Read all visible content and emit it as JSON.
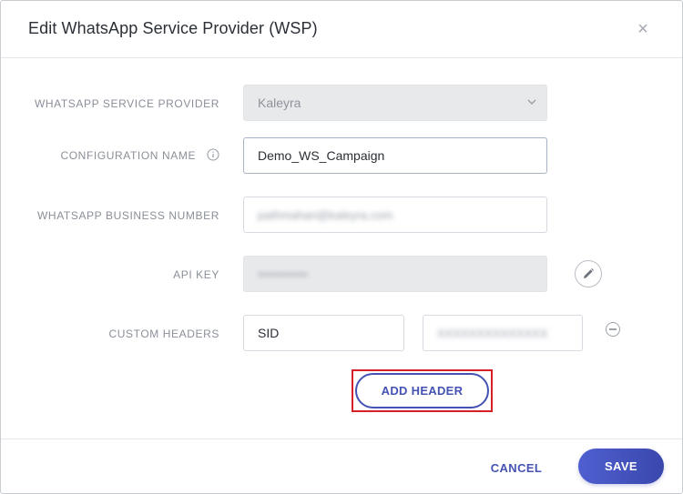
{
  "dialog": {
    "title": "Edit WhatsApp Service Provider (WSP)",
    "close_symbol": "×"
  },
  "form": {
    "provider": {
      "label": "WHATSAPP SERVICE PROVIDER",
      "value": "Kaleyra"
    },
    "config_name": {
      "label": "CONFIGURATION NAME",
      "value": "Demo_WS_Campaign"
    },
    "business_number": {
      "label": "WHATSAPP BUSINESS NUMBER",
      "value": "pathmahari@kaleyra.com"
    },
    "api_key": {
      "label": "API KEY",
      "value": "••••••••••••"
    },
    "custom_headers": {
      "label": "CUSTOM HEADERS",
      "header_name": "SID",
      "header_value": "XXXXXXXXXXXXXX"
    },
    "add_header_label": "ADD HEADER"
  },
  "footer": {
    "cancel_label": "CANCEL",
    "save_label": "SAVE"
  },
  "colors": {
    "accent": "#4453b3",
    "highlight": "#d61f26"
  }
}
